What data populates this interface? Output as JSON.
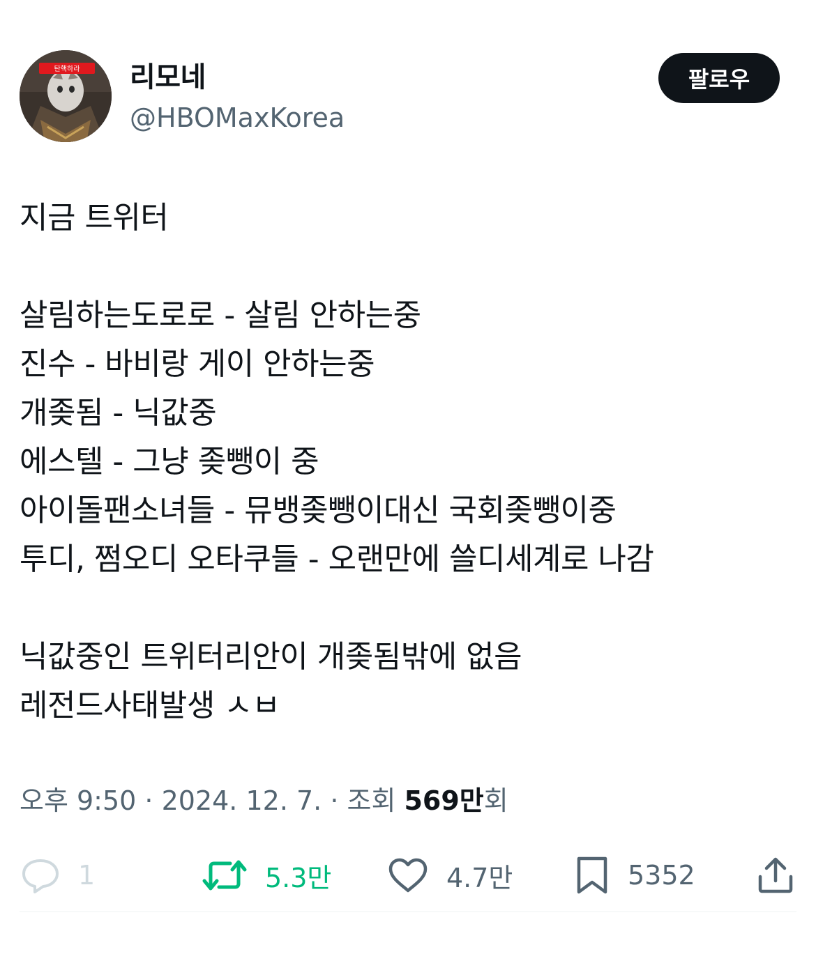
{
  "author": {
    "display_name": "리모네",
    "handle": "@HBOMaxKorea",
    "avatar_headband_text": "탄핵하라"
  },
  "follow_button": {
    "label": "팔로우"
  },
  "tweet": {
    "lines": [
      "지금 트위터",
      "",
      "살림하는도로로 - 살림 안하는중",
      "진수 - 바비랑 게이 안하는중",
      "개좆됨 - 닉값중",
      "에스텔 - 그냥 좆뺑이 중",
      "아이돌팬소녀들 - 뮤뱅좆뺑이대신 국회좆뺑이중",
      "투디, 쩜오디 오타쿠들 - 오랜만에 쓸디세계로 나감",
      "",
      "닉값중인 트위터리안이 개좆됨밖에 없음",
      "레전드사태발생 ㅅㅂ"
    ]
  },
  "meta": {
    "time": "오후 9:50",
    "sep1": " · ",
    "date": "2024. 12. 7.",
    "sep2": " · ",
    "views_prefix": "조회 ",
    "views_count": "569만",
    "views_suffix": "회"
  },
  "actions": {
    "reply": {
      "icon": "reply-icon",
      "count": "1"
    },
    "retweet": {
      "icon": "retweet-icon",
      "count": "5.3만",
      "color": "#00ba7c"
    },
    "like": {
      "icon": "heart-icon",
      "count": "4.7만"
    },
    "bookmark": {
      "icon": "bookmark-icon",
      "count": "5352"
    },
    "share": {
      "icon": "share-icon"
    }
  }
}
